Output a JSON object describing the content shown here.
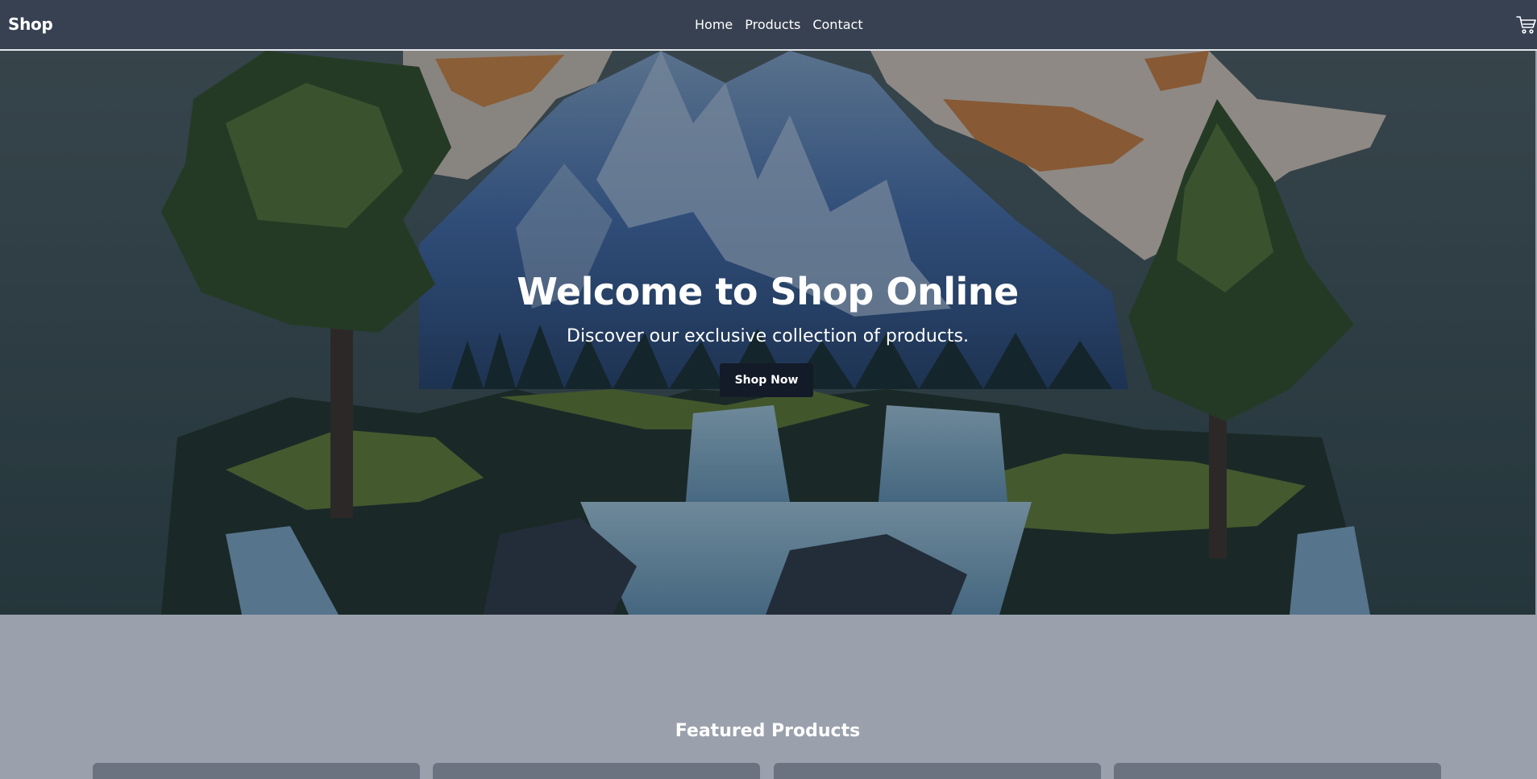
{
  "nav": {
    "brand": "Shop",
    "links": [
      "Home",
      "Products",
      "Contact"
    ],
    "cart_icon": "cart-icon"
  },
  "hero": {
    "title": "Welcome to Shop Online",
    "subtitle": "Discover our exclusive collection of products.",
    "button_label": "Shop Now"
  },
  "featured": {
    "title": "Featured Products",
    "cards": 4
  },
  "colors": {
    "navbar": "#374151",
    "page_bg": "#9aa1ad",
    "button": "#131a28",
    "card": "#6b7280"
  }
}
